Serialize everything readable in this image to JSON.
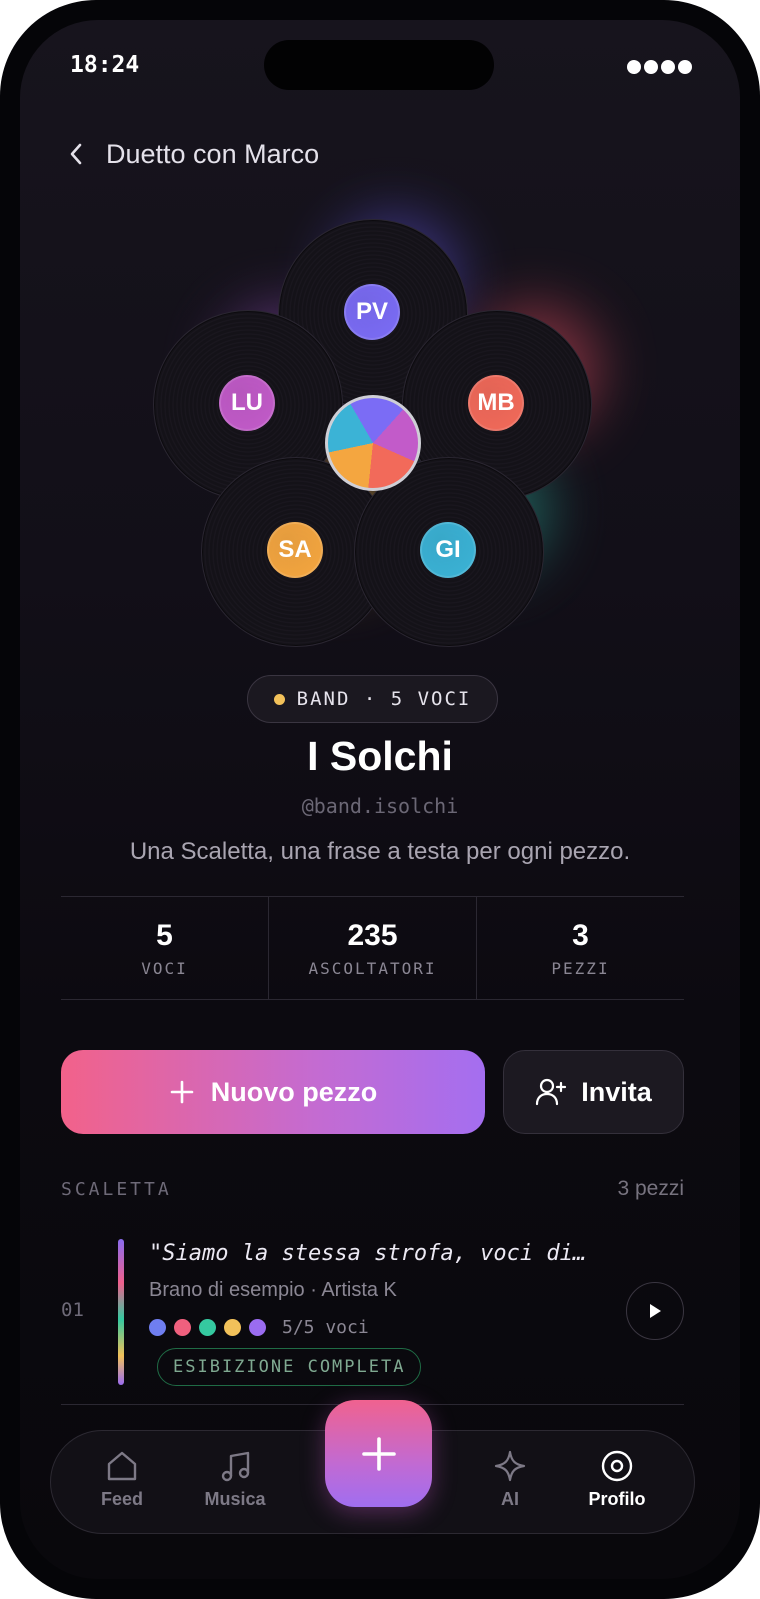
{
  "status_bar": {
    "time": "18:24"
  },
  "header": {
    "title": "Duetto con Marco"
  },
  "members": [
    {
      "initials": "PV",
      "color": "#7b6cf5"
    },
    {
      "initials": "LU",
      "color": "#c25bc9"
    },
    {
      "initials": "MB",
      "color": "#f26a5a"
    },
    {
      "initials": "SA",
      "color": "#f4a640"
    },
    {
      "initials": "GI",
      "color": "#3bb3d6"
    }
  ],
  "badge": {
    "label": "BAND · 5 VOCI",
    "color": "#f2c15a"
  },
  "band": {
    "name": "I Solchi",
    "handle": "@band.isolchi",
    "tagline": "Una Scaletta, una frase a testa per ogni pezzo."
  },
  "stats": [
    {
      "value": "5",
      "label": "VOCI"
    },
    {
      "value": "235",
      "label": "ASCOLTATORI"
    },
    {
      "value": "3",
      "label": "PEZZI"
    }
  ],
  "actions": {
    "new_piece": "Nuovo pezzo",
    "invite": "Invita"
  },
  "setlist": {
    "title": "SCALETTA",
    "count": "3 pezzi",
    "tracks": [
      {
        "number": "01",
        "quote": "\"Siamo la stessa strofa, voci di…",
        "meta": "Brano di esempio · Artista K",
        "voice_colors": [
          "#6f7ef0",
          "#f0607e",
          "#35c9a0",
          "#f2c15a",
          "#9a6cf0"
        ],
        "voices": "5/5 voci",
        "status": "ESIBIZIONE COMPLETA"
      }
    ]
  },
  "tabbar": {
    "items": [
      {
        "label": "Feed",
        "icon": "home-icon"
      },
      {
        "label": "Musica",
        "icon": "music-note-icon"
      },
      {
        "label": "AI",
        "icon": "sparkle-icon"
      },
      {
        "label": "Profilo",
        "icon": "disc-icon",
        "active": true
      }
    ],
    "fab_icon": "plus-icon"
  },
  "colors": {
    "accent_start": "#f2628a",
    "accent_end": "#a46ef0",
    "background": "#0c0a10"
  }
}
